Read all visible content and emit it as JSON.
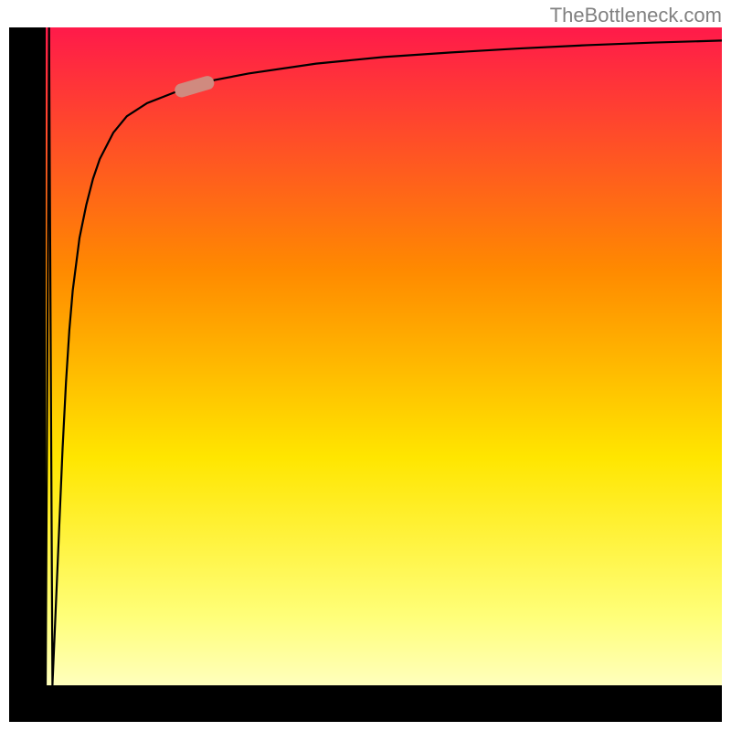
{
  "attribution": "TheBottleneck.com",
  "colors": {
    "attribution_text": "#808080",
    "axis": "#000000",
    "curve": "#000000",
    "marker_fill": "#d08a7f",
    "gradient_top": "#ff1a4a",
    "gradient_mid_upper": "#ff8a00",
    "gradient_mid": "#ffe600",
    "gradient_low": "#ffff7a",
    "gradient_bottom": "#00e676"
  },
  "chart_data": {
    "type": "line",
    "title": "",
    "xlabel": "",
    "ylabel": "",
    "xlim": [
      0,
      100
    ],
    "ylim": [
      0,
      100
    ],
    "series": [
      {
        "name": "curve",
        "x": [
          0,
          0.5,
          1,
          1.5,
          2,
          2.5,
          3,
          3.5,
          4,
          5,
          6,
          7,
          8,
          9,
          10,
          12,
          15,
          20,
          25,
          30,
          40,
          50,
          60,
          70,
          80,
          90,
          100
        ],
        "y": [
          0,
          100,
          0,
          12,
          24,
          36,
          46,
          54,
          60,
          68,
          73,
          77,
          80,
          82,
          84,
          86.5,
          88.5,
          90.5,
          92,
          93,
          94.5,
          95.5,
          96.2,
          96.8,
          97.3,
          97.7,
          98
        ]
      }
    ],
    "marker": {
      "x": 22,
      "y": 91
    },
    "grid": false,
    "legend": false
  }
}
